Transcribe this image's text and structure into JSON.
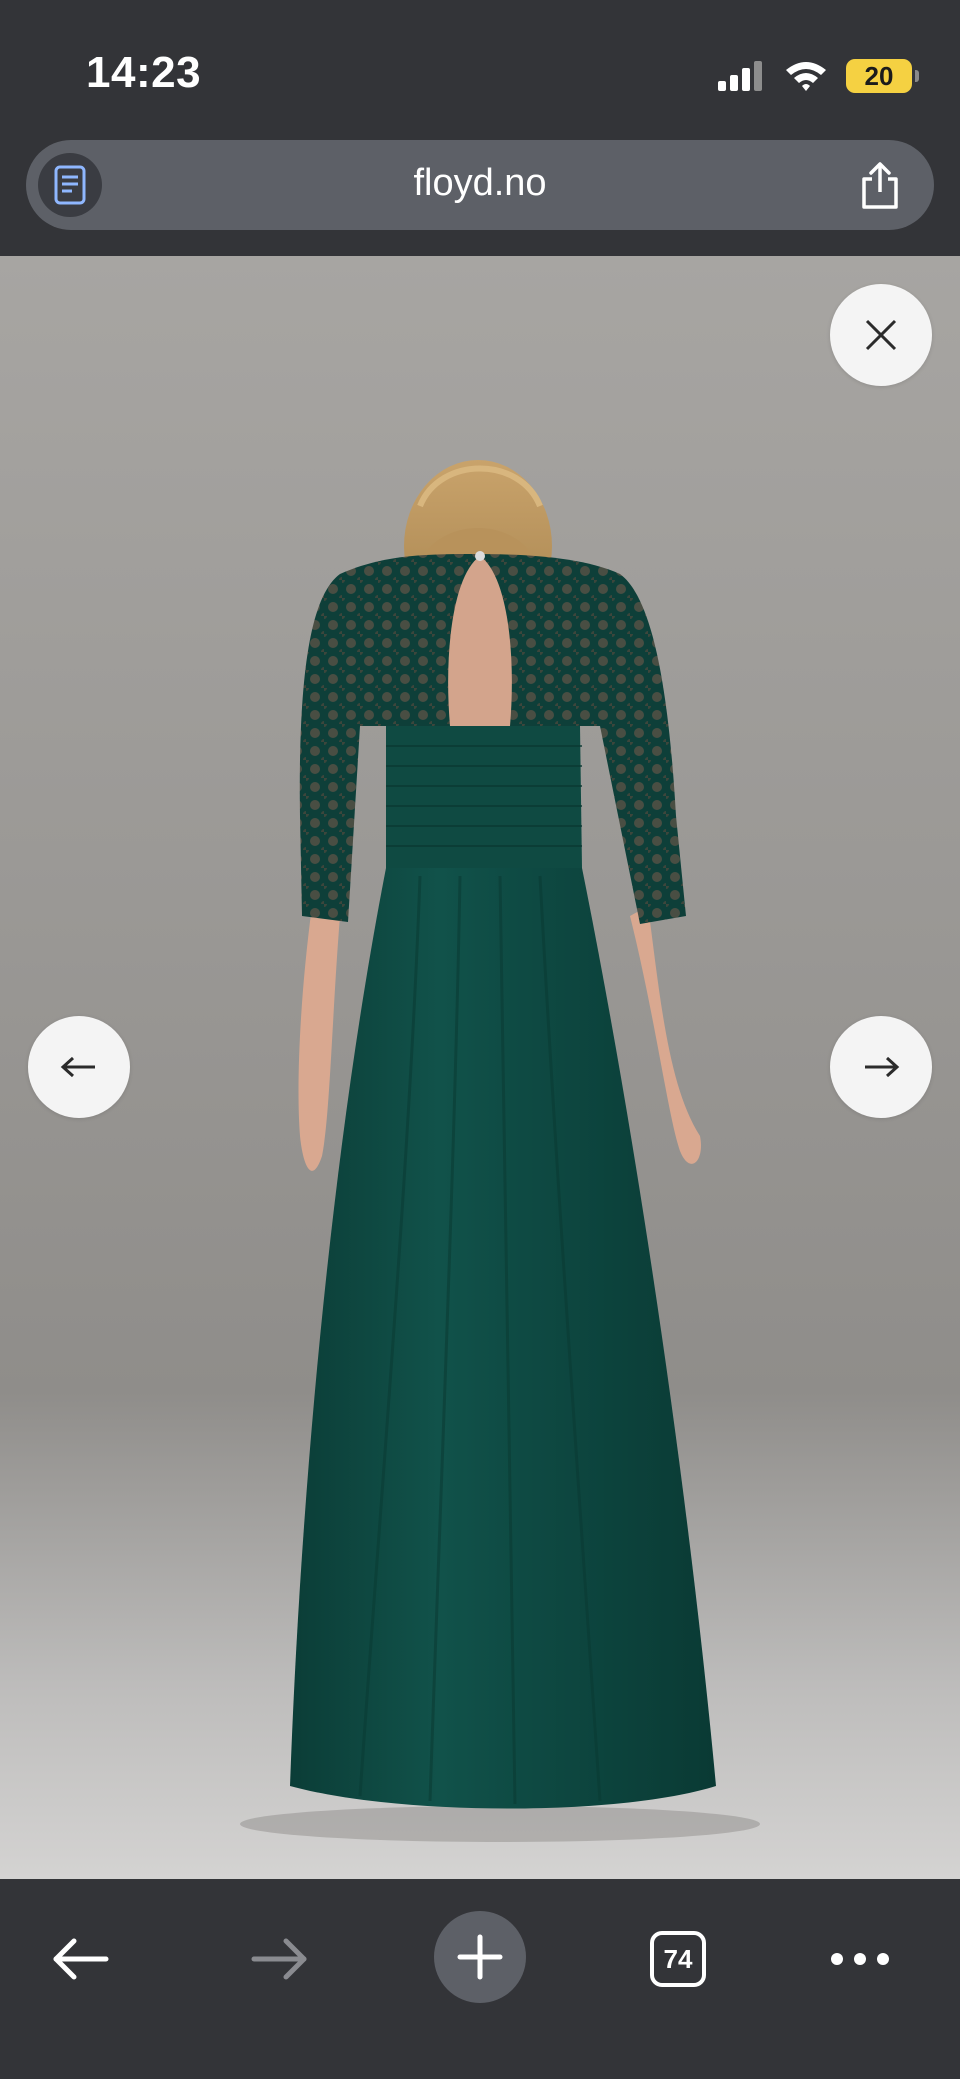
{
  "status_bar": {
    "time": "14:23",
    "battery_level": "20",
    "battery_color": "#f5d142",
    "icons": [
      "cellular-signal-icon",
      "wifi-icon",
      "battery-icon"
    ]
  },
  "browser": {
    "url": "floyd.no",
    "reader_icon": "reader-mode-icon",
    "share_icon": "share-icon"
  },
  "viewer": {
    "image_subject": "green lace maxi dress back view",
    "close_icon": "close-icon",
    "prev_icon": "arrow-left-icon",
    "next_icon": "arrow-right-icon",
    "dress_color": "#0f4a42"
  },
  "toolbar": {
    "back_icon": "back-icon",
    "forward_icon": "forward-icon",
    "new_tab_icon": "plus-icon",
    "tab_count": "74",
    "more_icon": "more-icon"
  }
}
